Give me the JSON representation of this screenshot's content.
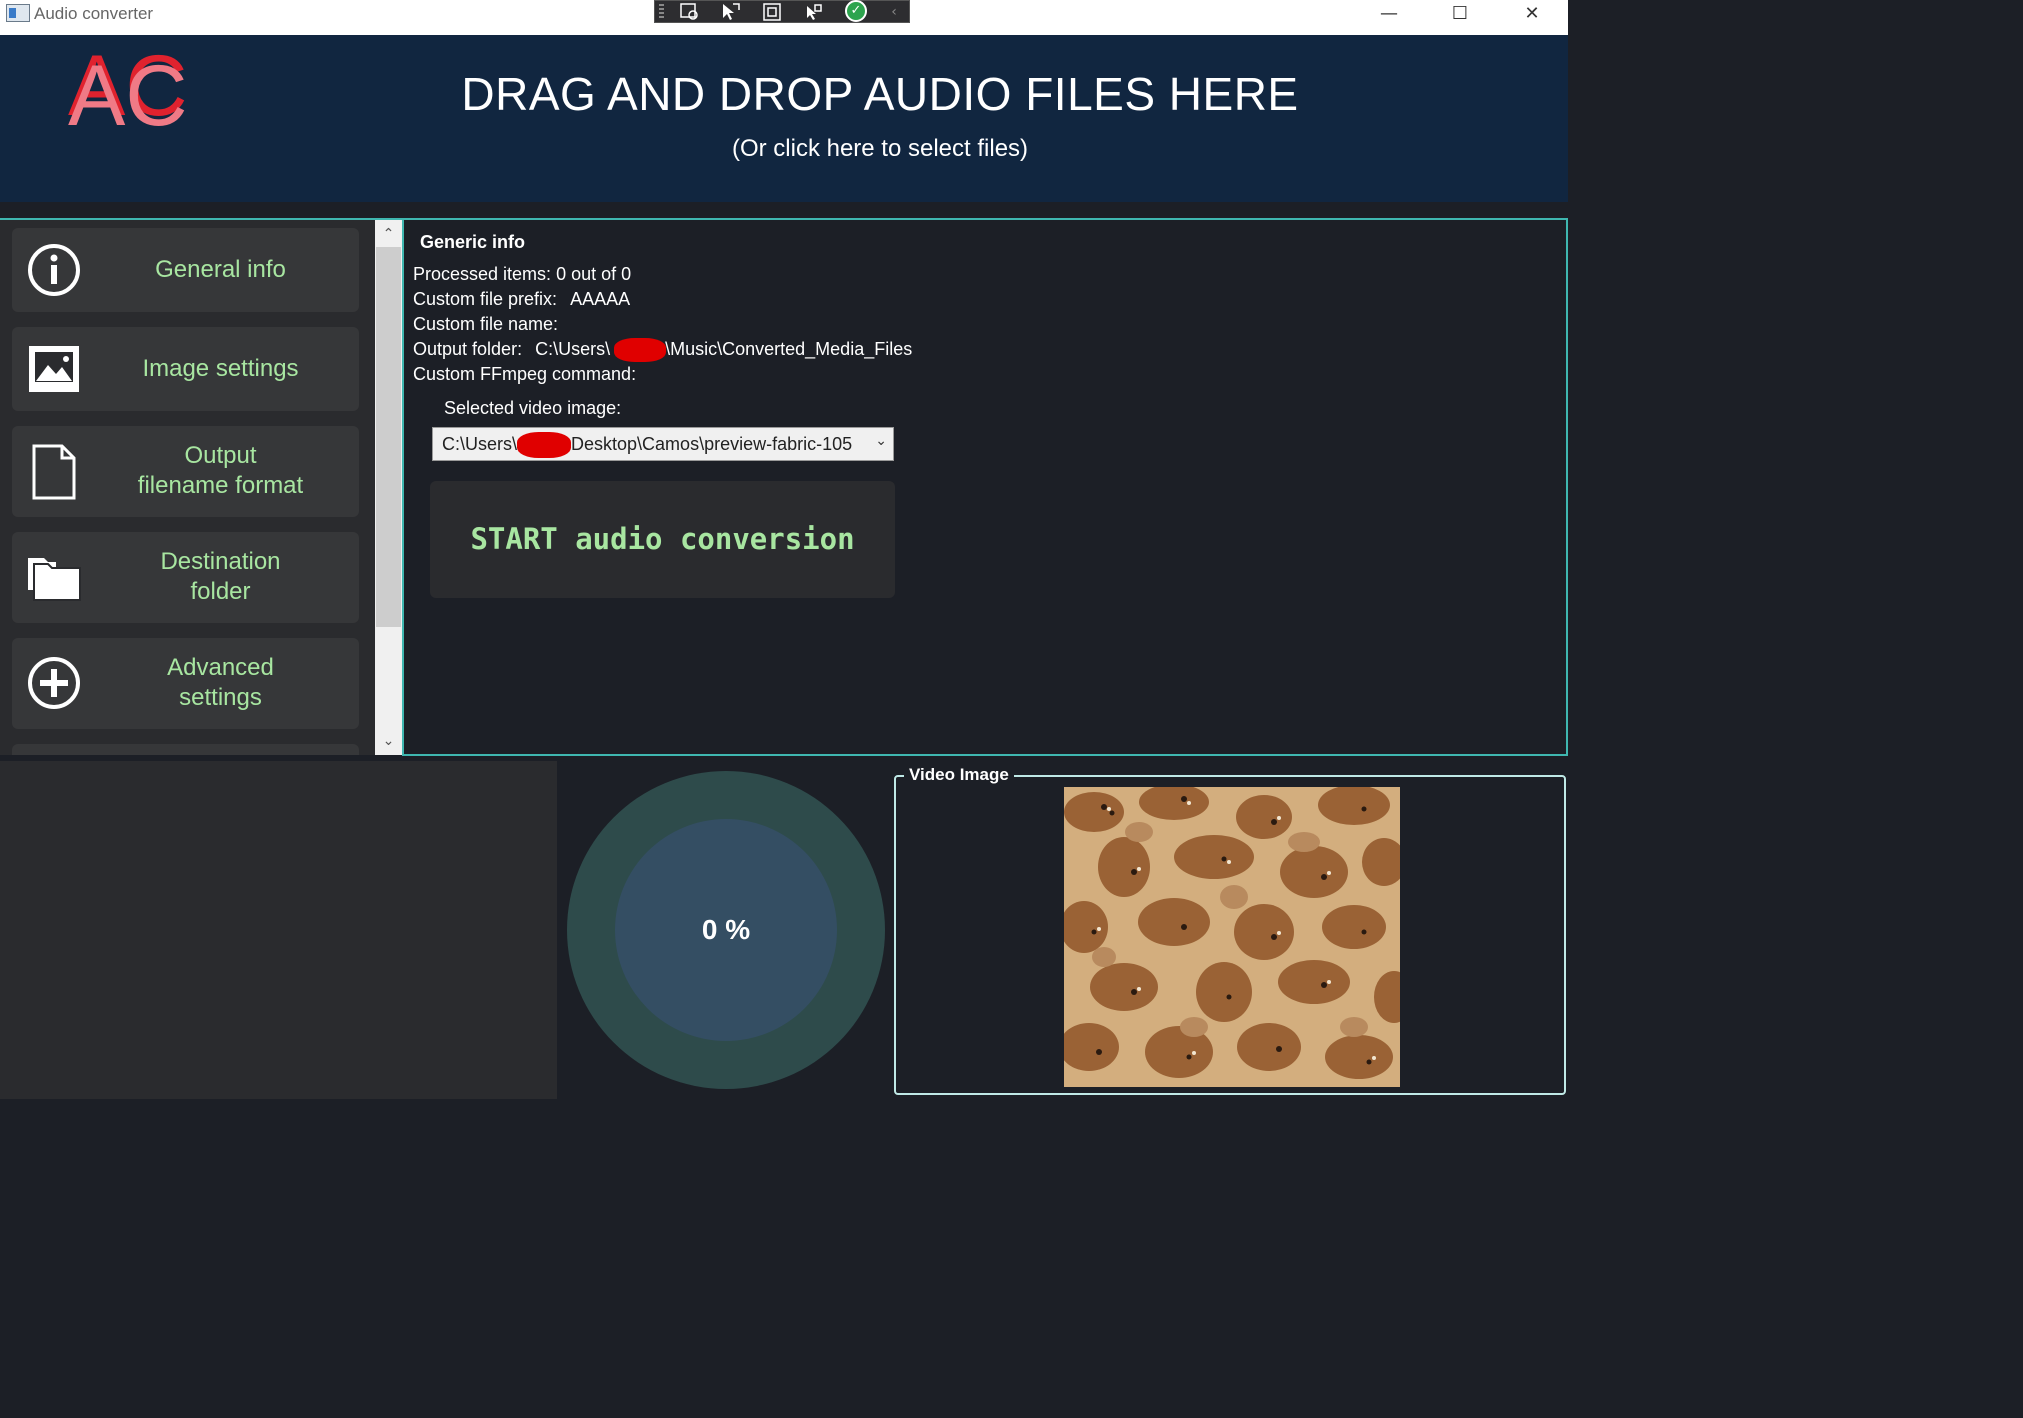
{
  "window": {
    "title": "Audio converter",
    "controls": {
      "minimize": "—",
      "maximize": "☐",
      "close": "✕"
    }
  },
  "debug_toolbar": {
    "icons": [
      "select-element-icon",
      "pointer-icon",
      "layout-bounds-icon",
      "track-focus-icon",
      "hot-reload-check-icon",
      "collapse-icon"
    ]
  },
  "header": {
    "logo_top": "AC",
    "logo_bottom": "AC",
    "drop_title": "DRAG AND DROP AUDIO FILES HERE",
    "drop_subtitle": "(Or click here to select files)",
    "colors": {
      "background": "#112640",
      "logo_top": "#e0222e",
      "logo_bottom": "#f07a86"
    }
  },
  "nav": {
    "items": [
      {
        "label": "General info",
        "icon": "info-icon"
      },
      {
        "label": "Image settings",
        "icon": "image-icon"
      },
      {
        "label": "Output\nfilename format",
        "icon": "file-icon"
      },
      {
        "label": "Destination\nfolder",
        "icon": "folder-icon"
      },
      {
        "label": "Advanced\nsettings",
        "icon": "plus-circle-icon"
      }
    ],
    "label_color": "#a8e6a1"
  },
  "info": {
    "title": "Generic info",
    "processed_label": "Processed items:",
    "processed_value": "0 out of 0",
    "prefix_label": "Custom file prefix:",
    "prefix_value": "AAAAA",
    "name_label": "Custom file name:",
    "name_value": "",
    "output_label": "Output folder:",
    "output_value_start": "C:\\Users\\",
    "output_value_end": "\\Music\\Converted_Media_Files",
    "ffmpeg_label": "Custom FFmpeg command:",
    "ffmpeg_value": "",
    "video_image_label": "Selected video image:",
    "video_image_value_start": "C:\\Users\\",
    "video_image_value_end": "Desktop\\Camos\\preview-fabric-105",
    "start_button": "START audio conversion"
  },
  "progress": {
    "percent": 0,
    "text": "0 %"
  },
  "video_image": {
    "legend": "Video Image"
  },
  "colors": {
    "accent": "#3fb7b0",
    "panel": "#2a2b2e",
    "background": "#1c1f26"
  }
}
